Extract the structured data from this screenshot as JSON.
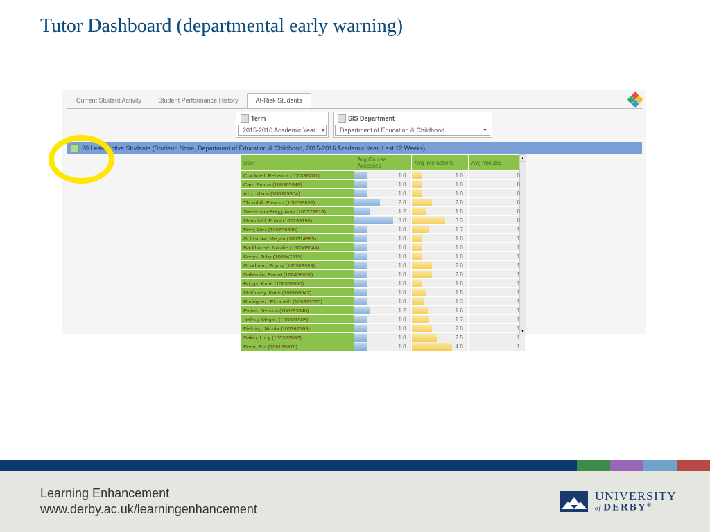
{
  "slide": {
    "title": "Tutor Dashboard (departmental early warning)"
  },
  "tabs": [
    {
      "label": "Current Student Activity",
      "active": false
    },
    {
      "label": "Student Performance History",
      "active": false
    },
    {
      "label": "At-Risk Students",
      "active": true
    }
  ],
  "filters": {
    "term": {
      "label": "Term",
      "value": "2015-2016 Academic Year"
    },
    "dept": {
      "label": "SIS Department",
      "value": "Department of Education & Childhood"
    }
  },
  "banner": "20 Least Active Students  (Student: None, Department of Education & Childhood, 2015-2016 Academic Year, Last 12 Weeks)",
  "columns": [
    "User",
    "Avg Course Accesses",
    "Avg Interactions",
    "Avg Minutes"
  ],
  "rows": [
    {
      "user": "Cracknell, Rebecca (100336701)",
      "v1": "1.0",
      "b1": 22,
      "v2": "1.0",
      "b2": 18,
      "v3": ".0"
    },
    {
      "user": "Carr, Emma (100365948)",
      "v1": "1.0",
      "b1": 22,
      "v2": "1.0",
      "b2": 18,
      "v3": ".0"
    },
    {
      "user": "Aziz, Maria (100329904)",
      "v1": "1.0",
      "b1": 22,
      "v2": "1.0",
      "b2": 18,
      "v3": ".0"
    },
    {
      "user": "Thornhill, Eleanor (100239839)",
      "v1": "2.0",
      "b1": 45,
      "v2": "2.0",
      "b2": 36,
      "v3": ".0"
    },
    {
      "user": "Stevenson-Pegg, Amy (100372818)",
      "v1": "1.2",
      "b1": 27,
      "v2": "1.5",
      "b2": 27,
      "v3": ".0"
    },
    {
      "user": "Mansfield, Fotini (100299195)",
      "v1": "3.0",
      "b1": 68,
      "v2": "3.3",
      "b2": 60,
      "v3": ".0"
    },
    {
      "user": "Peet, Alex (100268980)",
      "v1": "1.0",
      "b1": 22,
      "v2": "1.7",
      "b2": 31,
      "v3": ".1"
    },
    {
      "user": "Goldstraw, Megan (100314985)",
      "v1": "1.0",
      "b1": 22,
      "v2": "1.0",
      "b2": 18,
      "v3": ".1"
    },
    {
      "user": "Backhouse, Natalie (100368544)",
      "v1": "1.0",
      "b1": 22,
      "v2": "1.0",
      "b2": 18,
      "v3": ".1"
    },
    {
      "user": "Keeys, Toby (100347519)",
      "v1": "1.0",
      "b1": 22,
      "v2": "1.0",
      "b2": 18,
      "v3": ".1"
    },
    {
      "user": "Goodman, Poppy (100303399)",
      "v1": "1.0",
      "b1": 22,
      "v2": "2.0",
      "b2": 36,
      "v3": ".1"
    },
    {
      "user": "Dallemijn, Ewout (100408051)",
      "v1": "1.0",
      "b1": 22,
      "v2": "2.0",
      "b2": 36,
      "v3": ".1"
    },
    {
      "user": "Briggs, Katie (100369050)",
      "v1": "1.0",
      "b1": 22,
      "v2": "1.0",
      "b2": 18,
      "v3": ".1"
    },
    {
      "user": "McKinney, Katie (100160647)",
      "v1": "1.0",
      "b1": 22,
      "v2": "1.5",
      "b2": 27,
      "v3": ".1"
    },
    {
      "user": "Rodriguez, Elizabeth (100373720)",
      "v1": "1.0",
      "b1": 22,
      "v2": "1.3",
      "b2": 23,
      "v3": ".1"
    },
    {
      "user": "Evans, Jessica (100293540)",
      "v1": "1.2",
      "b1": 27,
      "v2": "1.6",
      "b2": 29,
      "v3": ".1"
    },
    {
      "user": "Jeffery, Megan (100361508)",
      "v1": "1.0",
      "b1": 22,
      "v2": "1.7",
      "b2": 31,
      "v3": ".1"
    },
    {
      "user": "Fielding, Nicola (100362169)",
      "v1": "1.0",
      "b1": 22,
      "v2": "2.0",
      "b2": 36,
      "v3": ".1"
    },
    {
      "user": "Dakin, Lucy (100322887)",
      "v1": "1.0",
      "b1": 22,
      "v2": "2.5",
      "b2": 45,
      "v3": ".1"
    },
    {
      "user": "Peart, Ria (100199976)",
      "v1": "1.0",
      "b1": 22,
      "v2": "4.0",
      "b2": 72,
      "v3": ".1"
    }
  ],
  "footer": {
    "line1": "Learning Enhancement",
    "line2": "www.derby.ac.uk/learningenhancement",
    "logo_top": "UNIVERSITY",
    "logo_of": "of ",
    "logo_derby": "DERBY",
    "logo_reg": "®"
  }
}
